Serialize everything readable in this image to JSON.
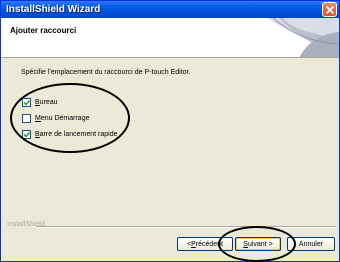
{
  "window": {
    "title": "InstallShield Wizard"
  },
  "header": {
    "title": "Ajouter raccourci"
  },
  "instructions": "Spécifie l'emplacement du raccourci de P-touch Editor.",
  "options": [
    {
      "label_first": "B",
      "label_rest": "ureau",
      "checked": true
    },
    {
      "label_first": "M",
      "label_rest": "enu Démarrage",
      "checked": false
    },
    {
      "label_first": "B",
      "label_rest": "arre de lancement rapide",
      "checked": true
    }
  ],
  "footer": {
    "brand": "InstallShield"
  },
  "buttons": {
    "back": {
      "before": "< ",
      "mnemonic": "P",
      "rest": "récédent"
    },
    "next": {
      "mnemonic": "S",
      "rest": "uivant >"
    },
    "cancel": {
      "label": "Annuler"
    }
  },
  "colors": {
    "title_bar": "#0050d8",
    "window_bg": "#ece9d8",
    "close": "#d4532e"
  },
  "icons": {
    "close": "close-icon",
    "check": "check-icon"
  }
}
